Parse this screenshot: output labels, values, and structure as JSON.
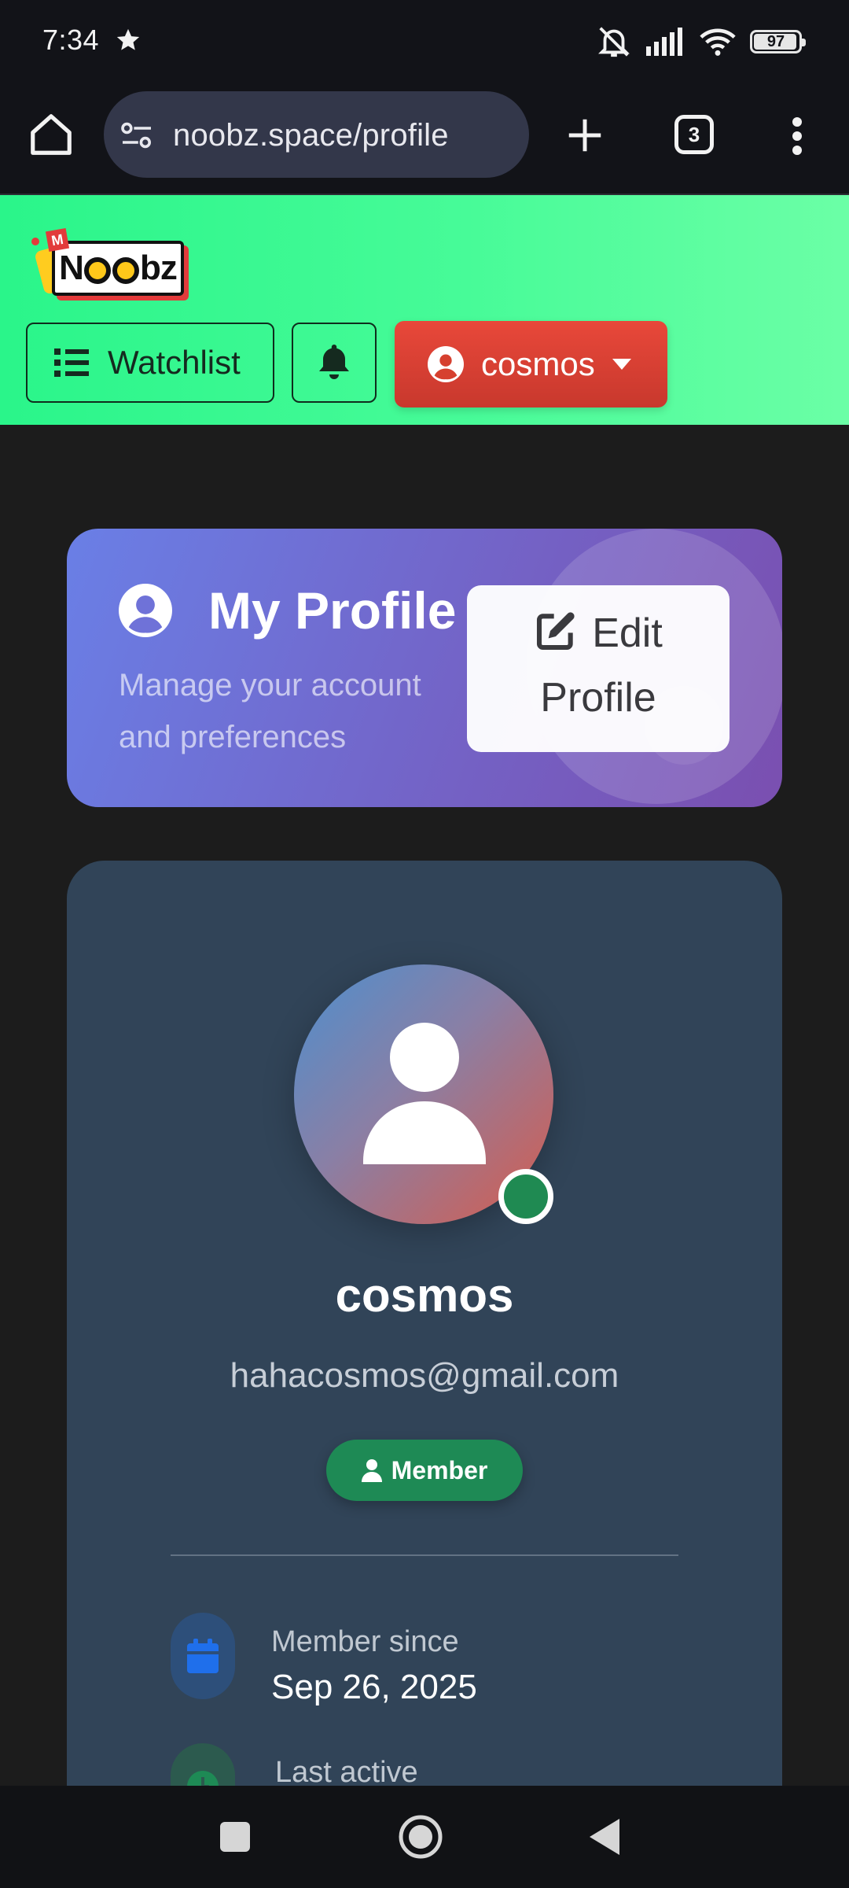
{
  "status_bar": {
    "time": "7:34",
    "battery": "97"
  },
  "browser": {
    "url": "noobz.space/profile",
    "tab_count": "3"
  },
  "site": {
    "logo_text_left": "N",
    "logo_text_right": "bz",
    "logo_mark": "M",
    "watchlist_label": "Watchlist",
    "user_menu_label": "cosmos"
  },
  "profile_header": {
    "title": "My Profile",
    "subtitle": "Manage your account and preferences",
    "edit_label_1": "Edit",
    "edit_label_2": "Profile"
  },
  "user": {
    "name": "cosmos",
    "email": "hahacosmos@gmail.com",
    "role": "Member",
    "online": true,
    "member_since_label": "Member since",
    "member_since_value": "Sep 26, 2025",
    "last_active_label": "Last active"
  },
  "colors": {
    "header_green": "#2af58a",
    "user_button_red": "#e8483a",
    "card_purple": "#7461c4",
    "member_green": "#1e8a55"
  },
  "icons": [
    "star-icon",
    "mute-icon",
    "signal-icon",
    "wifi-icon",
    "battery-icon",
    "home-icon",
    "tune-icon",
    "plus-icon",
    "tabs-icon",
    "more-vert-icon",
    "list-icon",
    "bell-icon",
    "user-circle-icon",
    "caret-down-icon",
    "edit-icon",
    "person-icon",
    "calendar-icon",
    "clock-icon",
    "square-icon",
    "circle-icon",
    "back-triangle-icon"
  ]
}
